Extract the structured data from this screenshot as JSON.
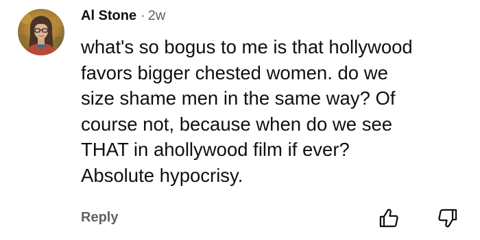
{
  "comment": {
    "author": "Al Stone",
    "separator": "·",
    "time": "2w",
    "body_lines": [
      "what's so bogus to me is that hollywood",
      "favors bigger chested women. do we",
      "size shame men in the same way? Of",
      "course not, because when do we see",
      "THAT in ahollywood film if ever?",
      "Absolute hypocrisy."
    ]
  },
  "actions": {
    "reply_label": "Reply",
    "like_icon": "thumbs-up-icon",
    "dislike_icon": "thumbs-down-icon"
  },
  "colors": {
    "text_primary": "#0f0f0f",
    "text_secondary": "#606060",
    "background": "#ffffff"
  }
}
